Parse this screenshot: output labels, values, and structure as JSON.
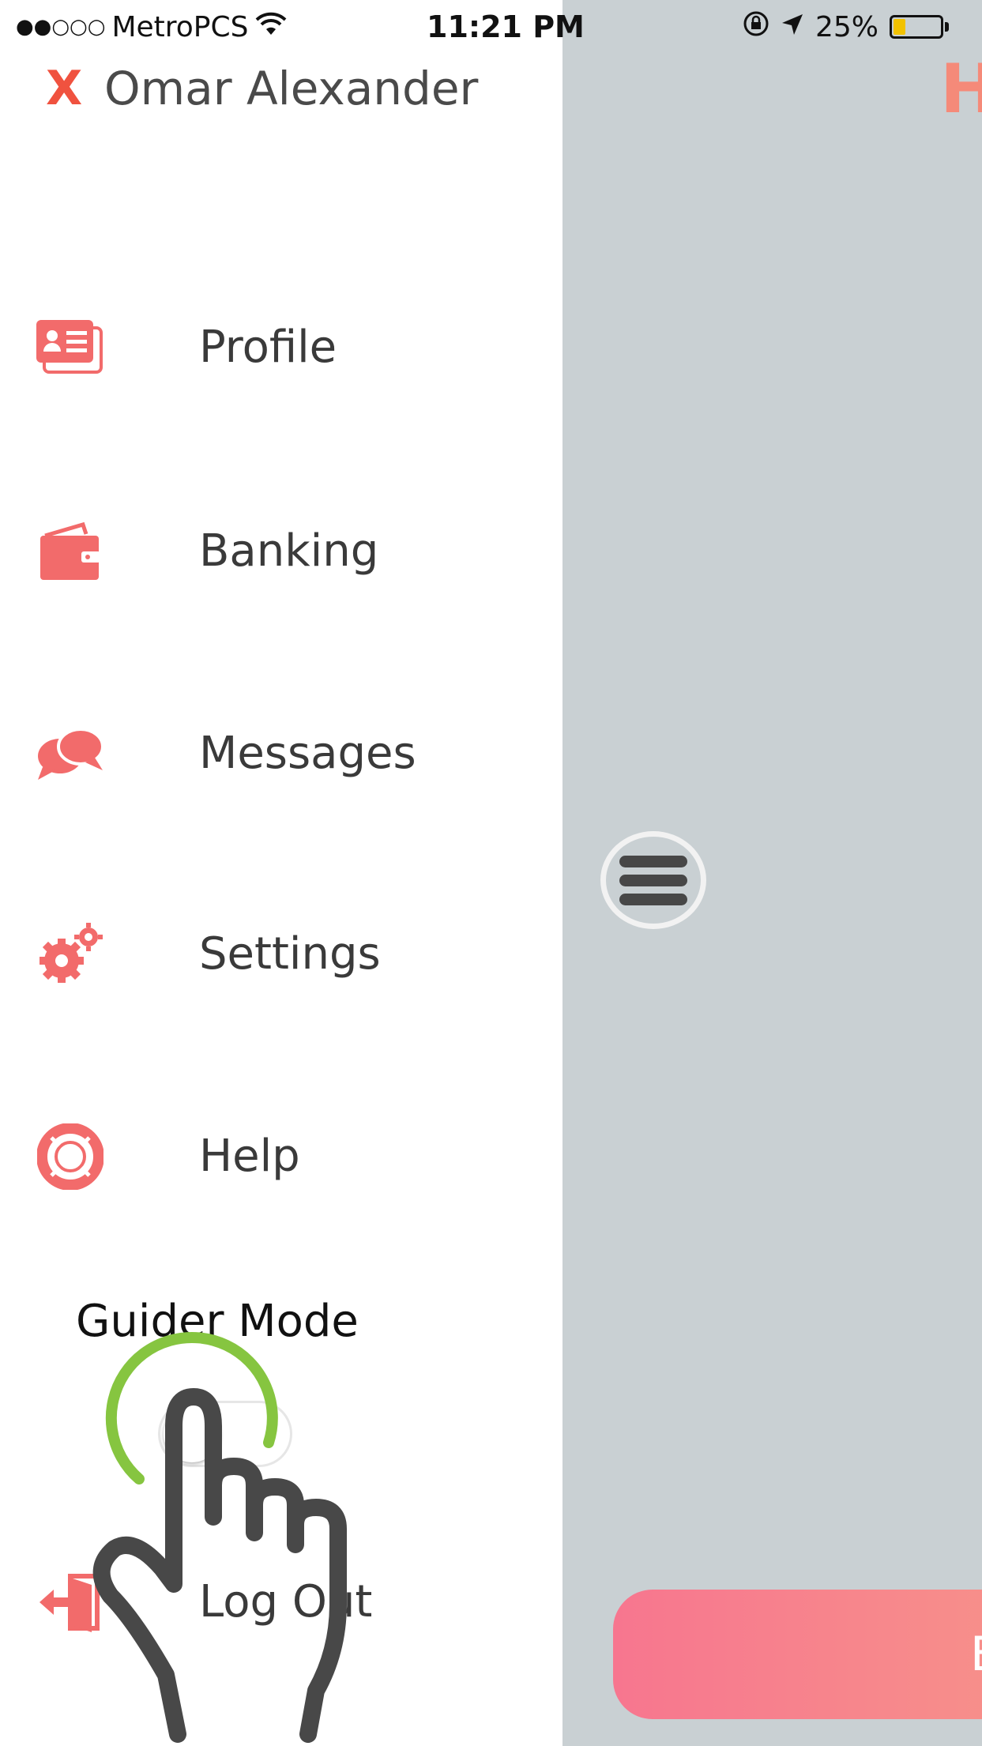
{
  "status_bar": {
    "signal": "●●○○○",
    "carrier": "MetroPCS",
    "time": "11:21 PM",
    "battery_percent": "25%",
    "battery_level": 0.25
  },
  "drawer": {
    "close_label": "X",
    "user_name": "Omar Alexander",
    "menu": [
      {
        "label": "Profile",
        "icon": "profile-card-icon"
      },
      {
        "label": "Banking",
        "icon": "wallet-icon"
      },
      {
        "label": "Messages",
        "icon": "chat-bubbles-icon"
      },
      {
        "label": "Settings",
        "icon": "gears-icon"
      },
      {
        "label": "Help",
        "icon": "lifebuoy-icon"
      }
    ],
    "guider_mode_label": "Guider Mode",
    "guider_mode_on": false,
    "logout_label": "Log Out"
  },
  "main": {
    "title_fragment": "H",
    "bottom_button_fragment": "E"
  },
  "colors": {
    "accent": "#f26b6b",
    "main_bg": "#c9d0d3",
    "gesture_ring": "#86c540",
    "gesture_hand": "#484848"
  }
}
